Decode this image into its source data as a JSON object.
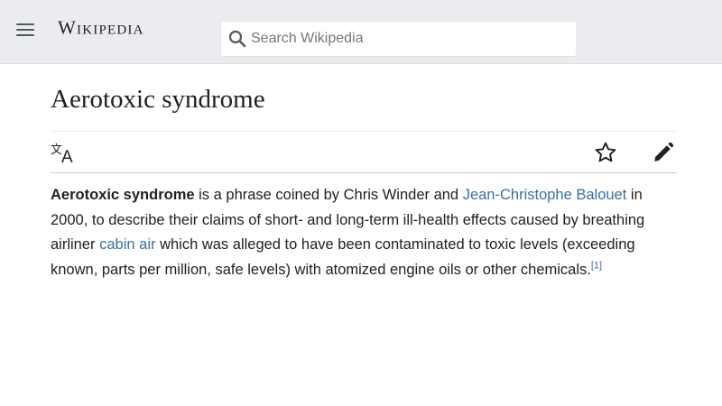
{
  "header": {
    "menu_icon": "hamburger-menu-icon",
    "wordmark": "Wikipedia",
    "search": {
      "icon": "search-icon",
      "placeholder": "Search Wikipedia"
    }
  },
  "article": {
    "title": "Aerotoxic syndrome",
    "actions": {
      "language_icon": "language-icon",
      "watch_icon": "star-icon",
      "edit_icon": "pencil-icon"
    },
    "lead": {
      "bold_term": "Aerotoxic syndrome",
      "text_1": " is a phrase coined by Chris Winder and ",
      "link_1": "Jean-Christophe Balouet",
      "text_2": " in 2000, to describe their claims of short- and long-term ill-health effects caused by breathing airliner ",
      "link_2": "cabin air",
      "text_3": " which was alleged to have been contaminated to toxic levels (exceeding known, parts per million, safe levels) with atomized engine oils or other chemicals.",
      "citation": "[1]"
    }
  },
  "colors": {
    "header_bg": "#eaecf0",
    "link": "#3a6fa0",
    "text": "#202122",
    "placeholder": "#72777d"
  }
}
